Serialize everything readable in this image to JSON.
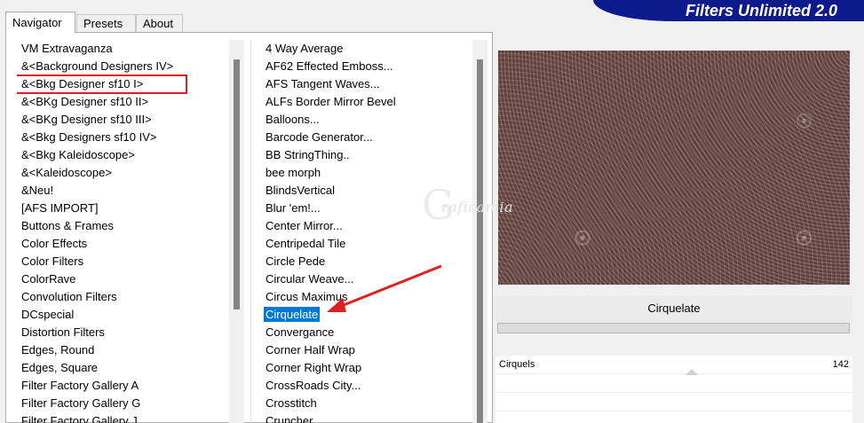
{
  "app": {
    "banner_title": "Filters Unlimited 2.0"
  },
  "tabs": [
    {
      "label": "Navigator"
    },
    {
      "label": "Presets"
    },
    {
      "label": "About"
    }
  ],
  "categories": [
    "VM Extravaganza",
    "&<Background Designers IV>",
    "&<Bkg Designer sf10 I>",
    "&<BKg Designer sf10 II>",
    "&<BKg Designer sf10 III>",
    "&<Bkg Designers sf10 IV>",
    "&<Bkg Kaleidoscope>",
    "&<Kaleidoscope>",
    "&Neu!",
    "[AFS IMPORT]",
    "Buttons & Frames",
    "Color Effects",
    "Color Filters",
    "ColorRave",
    "Convolution Filters",
    "DCspecial",
    "Distortion Filters",
    "Edges, Round",
    "Edges, Square",
    "Filter Factory Gallery A",
    "Filter Factory Gallery G",
    "Filter Factory Gallery J"
  ],
  "filters": [
    "4 Way Average",
    "AF62 Effected Emboss...",
    "AFS Tangent Waves...",
    "ALFs Border Mirror Bevel",
    "Balloons...",
    "Barcode Generator...",
    "BB StringThing..",
    "bee morph",
    "BlindsVertical",
    "Blur 'em!...",
    "Center Mirror...",
    "Centripedal Tile",
    "Circle Pede",
    "Circular Weave...",
    "Circus Maximus",
    "Cirquelate",
    "Convergance",
    "Corner Half Wrap",
    "Corner Right Wrap",
    "CrossRoads City...",
    "Crosstitch",
    "Cruncher"
  ],
  "selected_filter": "Cirquelate",
  "highlighted_category": "&<Bkg Designer sf10 I>",
  "watermark": {
    "big": "G",
    "small": "raficamia"
  },
  "params": [
    {
      "label": "Cirquels",
      "value": "142"
    }
  ],
  "colors": {
    "selection": "#0078d7",
    "highlight_box": "#e02020",
    "banner": "#0d1a8c",
    "arrow": "#e02020"
  }
}
